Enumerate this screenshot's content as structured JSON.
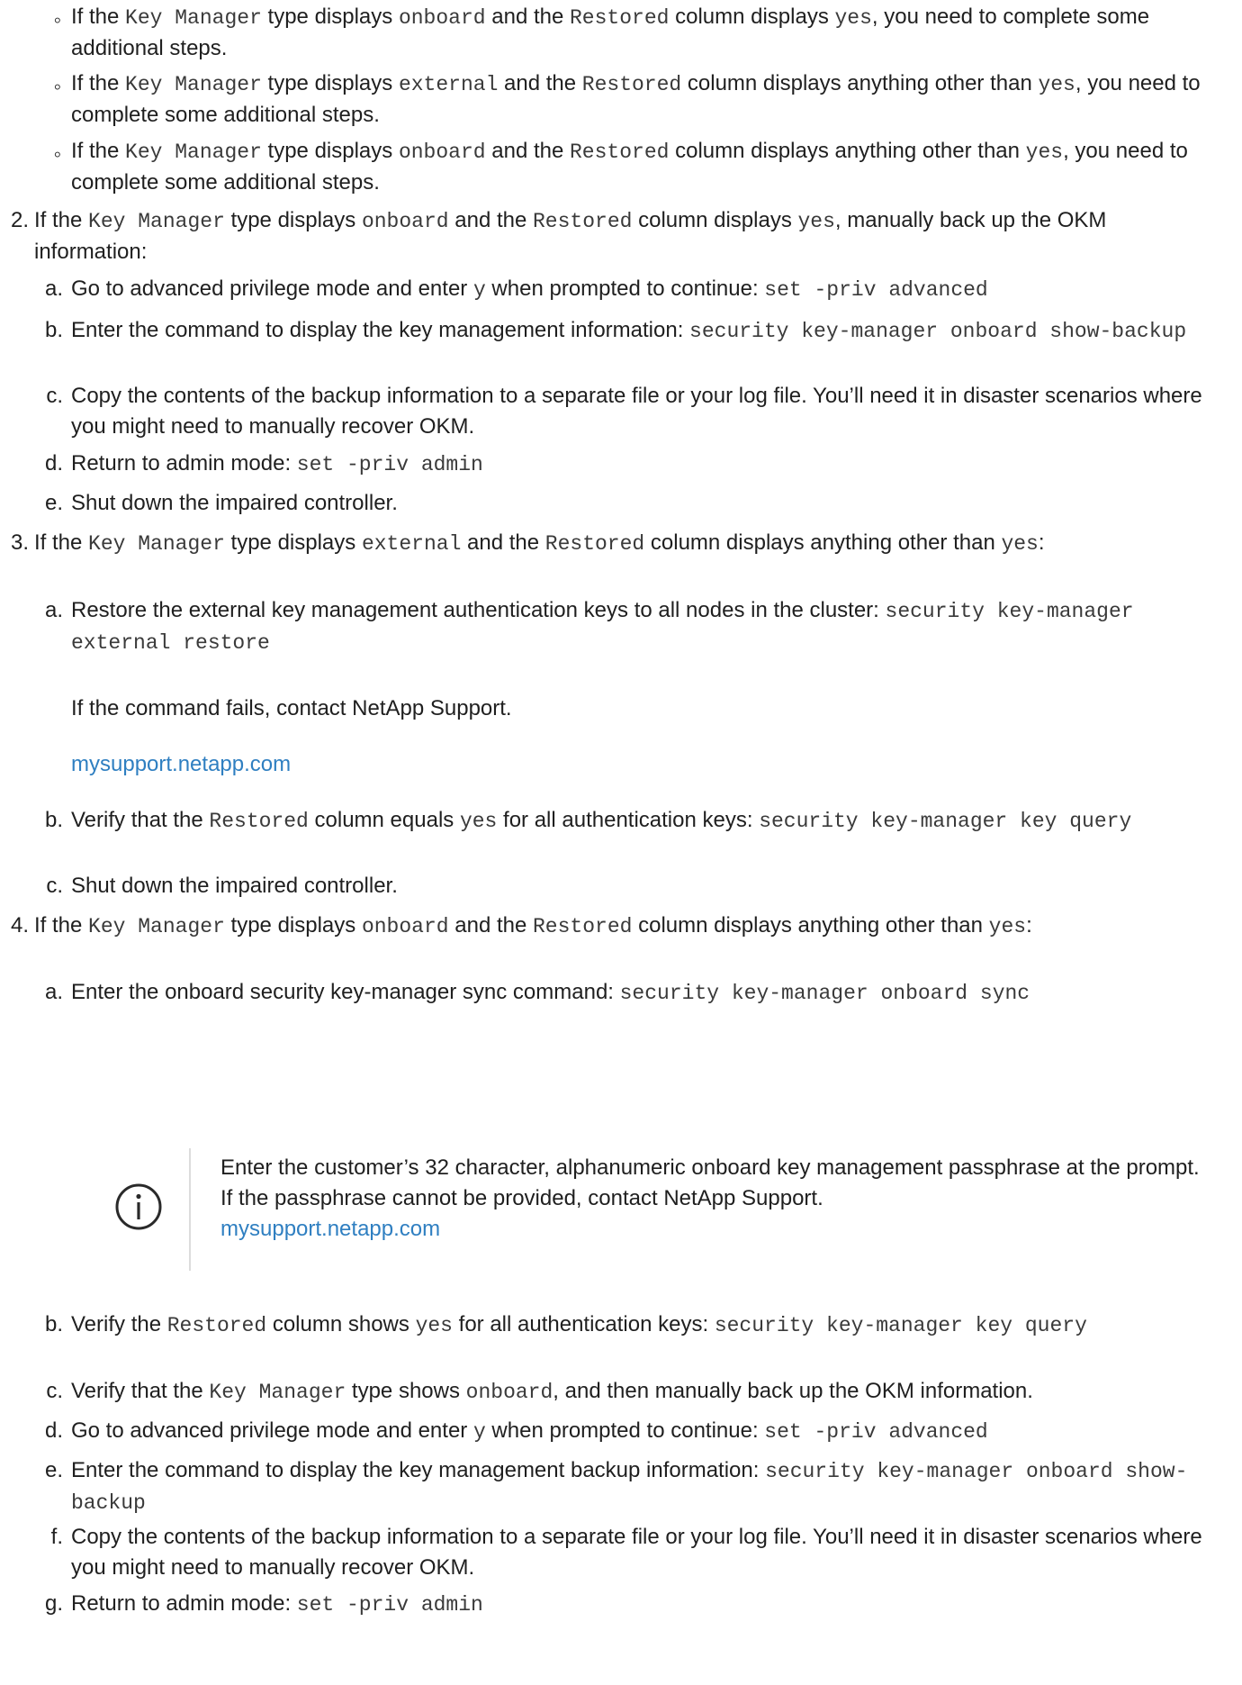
{
  "sub_bullets": [
    {
      "marker": "◦",
      "parts": [
        [
          "t",
          "If the "
        ],
        [
          "c",
          "Key Manager"
        ],
        [
          "t",
          " type displays "
        ],
        [
          "c",
          "onboard"
        ],
        [
          "t",
          " and the "
        ],
        [
          "c",
          "Restored"
        ],
        [
          "t",
          " column displays "
        ],
        [
          "c",
          "yes"
        ],
        [
          "t",
          ", you need to complete some additional steps."
        ]
      ]
    },
    {
      "marker": "◦",
      "parts": [
        [
          "t",
          "If the "
        ],
        [
          "c",
          "Key Manager"
        ],
        [
          "t",
          " type displays "
        ],
        [
          "c",
          "external"
        ],
        [
          "t",
          " and the "
        ],
        [
          "c",
          "Restored"
        ],
        [
          "t",
          " column displays anything other than "
        ],
        [
          "c",
          "yes"
        ],
        [
          "t",
          ", you need to complete some additional steps."
        ]
      ]
    },
    {
      "marker": "◦",
      "parts": [
        [
          "t",
          "If the "
        ],
        [
          "c",
          "Key Manager"
        ],
        [
          "t",
          " type displays "
        ],
        [
          "c",
          "onboard"
        ],
        [
          "t",
          " and the "
        ],
        [
          "c",
          "Restored"
        ],
        [
          "t",
          " column displays anything other than "
        ],
        [
          "c",
          "yes"
        ],
        [
          "t",
          ", you need to complete some additional steps."
        ]
      ]
    }
  ],
  "steps": [
    {
      "marker": "2.",
      "parts": [
        [
          "t",
          "If the "
        ],
        [
          "c",
          "Key Manager"
        ],
        [
          "t",
          " type displays "
        ],
        [
          "c",
          "onboard"
        ],
        [
          "t",
          " and the "
        ],
        [
          "c",
          "Restored"
        ],
        [
          "t",
          " column displays "
        ],
        [
          "c",
          "yes"
        ],
        [
          "t",
          ", manually back up the OKM information:"
        ]
      ],
      "substeps": [
        {
          "marker": "a.",
          "parts": [
            [
              "t",
              "Go to advanced privilege mode and enter "
            ],
            [
              "c",
              "y"
            ],
            [
              "t",
              " when prompted to continue: "
            ],
            [
              "c",
              "set -priv advanced"
            ]
          ]
        },
        {
          "marker": "b.",
          "parts": [
            [
              "t",
              "Enter the command to display the key management information: "
            ],
            [
              "c",
              "security key-manager onboard show-backup"
            ]
          ]
        },
        {
          "marker": "c.",
          "parts": [
            [
              "t",
              "Copy the contents of the backup information to a separate file or your log file. You’ll need it in disaster scenarios where you might need to manually recover OKM."
            ]
          ]
        },
        {
          "marker": "d.",
          "parts": [
            [
              "t",
              "Return to admin mode: "
            ],
            [
              "c",
              "set -priv admin"
            ]
          ]
        },
        {
          "marker": "e.",
          "parts": [
            [
              "t",
              "Shut down the impaired controller."
            ]
          ]
        }
      ]
    },
    {
      "marker": "3.",
      "parts": [
        [
          "t",
          "If the "
        ],
        [
          "c",
          "Key Manager"
        ],
        [
          "t",
          " type displays "
        ],
        [
          "c",
          "external"
        ],
        [
          "t",
          " and the "
        ],
        [
          "c",
          "Restored"
        ],
        [
          "t",
          " column displays anything other than "
        ],
        [
          "c",
          "yes"
        ],
        [
          "t",
          ":"
        ]
      ],
      "substeps": [
        {
          "marker": "a.",
          "parts": [
            [
              "t",
              "Restore the external key management authentication keys to all nodes in the cluster: "
            ],
            [
              "c",
              "security key-manager external restore"
            ]
          ]
        },
        {
          "marker": "",
          "parts": [
            [
              "t",
              "If the command fails, contact NetApp Support."
            ]
          ]
        },
        {
          "marker": "",
          "parts": [
            [
              "l",
              "mysupport.netapp.com"
            ]
          ]
        },
        {
          "marker": "b.",
          "parts": [
            [
              "t",
              "Verify that the "
            ],
            [
              "c",
              "Restored"
            ],
            [
              "t",
              " column equals "
            ],
            [
              "c",
              "yes"
            ],
            [
              "t",
              " for all authentication keys: "
            ],
            [
              "c",
              "security key-manager key query"
            ]
          ]
        },
        {
          "marker": "c.",
          "parts": [
            [
              "t",
              "Shut down the impaired controller."
            ]
          ]
        }
      ]
    },
    {
      "marker": "4.",
      "parts": [
        [
          "t",
          "If the "
        ],
        [
          "c",
          "Key Manager"
        ],
        [
          "t",
          " type displays "
        ],
        [
          "c",
          "onboard"
        ],
        [
          "t",
          " and the "
        ],
        [
          "c",
          "Restored"
        ],
        [
          "t",
          " column displays anything other than "
        ],
        [
          "c",
          "yes"
        ],
        [
          "t",
          ":"
        ]
      ],
      "substeps": [
        {
          "marker": "a.",
          "parts": [
            [
              "t",
              "Enter the onboard security key-manager sync command: "
            ],
            [
              "c",
              "security key-manager onboard sync"
            ]
          ]
        },
        {
          "marker": "b.",
          "parts": [
            [
              "t",
              "Verify the "
            ],
            [
              "c",
              "Restored"
            ],
            [
              "t",
              " column shows "
            ],
            [
              "c",
              "yes"
            ],
            [
              "t",
              " for all authentication keys: "
            ],
            [
              "c",
              "security key-manager key query"
            ]
          ]
        },
        {
          "marker": "c.",
          "parts": [
            [
              "t",
              "Verify that the "
            ],
            [
              "c",
              "Key Manager"
            ],
            [
              "t",
              " type shows "
            ],
            [
              "c",
              "onboard"
            ],
            [
              "t",
              ", and then manually back up the OKM information."
            ]
          ]
        },
        {
          "marker": "d.",
          "parts": [
            [
              "t",
              "Go to advanced privilege mode and enter "
            ],
            [
              "c",
              "y"
            ],
            [
              "t",
              " when prompted to continue: "
            ],
            [
              "c",
              "set -priv advanced"
            ]
          ]
        },
        {
          "marker": "e.",
          "parts": [
            [
              "t",
              "Enter the command to display the key management backup information: "
            ],
            [
              "c",
              "security key-manager onboard show-backup"
            ]
          ]
        },
        {
          "marker": "f.",
          "parts": [
            [
              "t",
              "Copy the contents of the backup information to a separate file or your log file. You’ll need it in disaster scenarios where you might need to manually recover OKM."
            ]
          ]
        },
        {
          "marker": "g.",
          "parts": [
            [
              "t",
              "Return to admin mode: "
            ],
            [
              "c",
              "set -priv admin"
            ]
          ]
        }
      ]
    }
  ],
  "note": {
    "icon": "info-icon",
    "text": "Enter the customer’s 32 character, alphanumeric onboard key management passphrase at the prompt. If the passphrase cannot be provided, contact NetApp Support.",
    "link": "mysupport.netapp.com"
  },
  "colors": {
    "link": "#2f7fc1",
    "text": "#1f1f1f",
    "code": "#3a3a3a"
  }
}
